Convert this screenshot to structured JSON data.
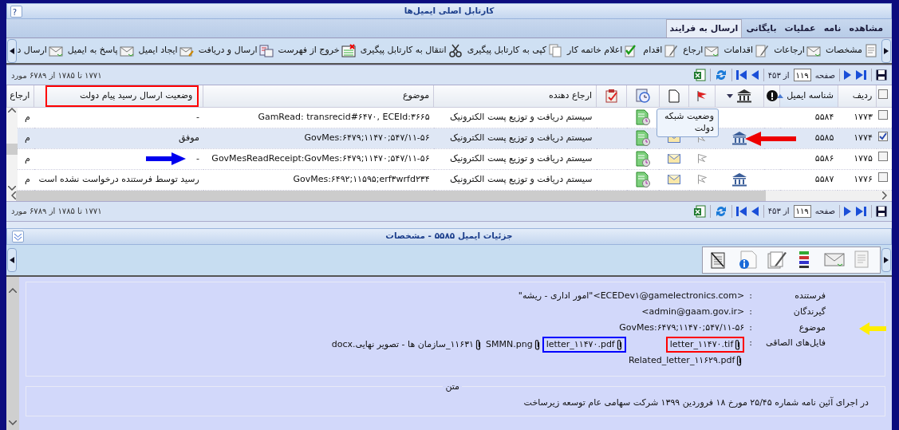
{
  "window": {
    "title": "کارتابل اصلی ایمیل‌ها",
    "help": "?"
  },
  "tabs": [
    {
      "label": "مشاهده",
      "selected": false
    },
    {
      "label": "نامه",
      "selected": false
    },
    {
      "label": "عملیات",
      "selected": false
    },
    {
      "label": "بایگانی",
      "selected": false
    },
    {
      "label": "ارسال به فرایند",
      "selected": true
    }
  ],
  "toolbar": [
    {
      "label": "مشخصات"
    },
    {
      "label": "ارجاعات"
    },
    {
      "label": "اقدامات"
    },
    {
      "label": "ارجاع"
    },
    {
      "label": "اقدام"
    },
    {
      "label": "اعلام خاتمه کار"
    },
    {
      "label": "کپی به کارتابل پیگیری"
    },
    {
      "label": "انتقال به کارتابل پیگیری"
    },
    {
      "label": "خروج از فهرست"
    },
    {
      "label": "ارسال و دریافت"
    },
    {
      "label": "ایجاد ایمیل"
    },
    {
      "label": "پاسخ به ایمیل"
    },
    {
      "label": "ارسال د"
    }
  ],
  "pager_top": {
    "page_label": "صفحه",
    "page": "۱۱۹",
    "of": "از ۴۵۳",
    "summary": "۱۷۷۱ تا ۱۷۸۵ از ۶۷۸۹ مورد"
  },
  "grid": {
    "columns": [
      {
        "kind": "check"
      },
      {
        "kind": "text",
        "label": "ردیف"
      },
      {
        "kind": "text",
        "label": "شناسه ایمیل",
        "sorted": true
      },
      {
        "kind": "icon"
      },
      {
        "kind": "icon",
        "dropdown": true
      },
      {
        "kind": "icon"
      },
      {
        "kind": "icon"
      },
      {
        "kind": "icon"
      },
      {
        "kind": "icon"
      },
      {
        "kind": "text",
        "label": "ارجاع دهنده"
      },
      {
        "kind": "text",
        "label": "موضوع"
      },
      {
        "kind": "text",
        "label": "وضعیت ارسال رسید پیام دولت",
        "annotation": {
          "kind": "box",
          "color": "#ff0000"
        }
      },
      {
        "kind": "text",
        "label": "ارجاع"
      }
    ],
    "select_all": {
      "checked": false
    },
    "tooltip": "وضعیت شبکه دولت",
    "rows": [
      {
        "checked": false,
        "selected": false,
        "row_no": "۱۷۷۳",
        "email_id": "۵۵۸۴",
        "gov_network": false,
        "sender": "سیستم دریافت و توزیع پست الکترونیک",
        "subject": "GamRead: transrecid#۶۴۷۰, ECEId:۳۶۶۵",
        "status": "-",
        "referral": "م"
      },
      {
        "checked": true,
        "selected": true,
        "row_no": "۱۷۷۴",
        "email_id": "۵۵۸۵",
        "gov_network": true,
        "flag": true,
        "envelope": true,
        "sender": "سیستم دریافت و توزیع پست الکترونیک",
        "subject": "GovMes:۶۴۷۹;۱۱۴۷۰;۵۴۷/۱۱-۵۶",
        "status": "موفق",
        "referral": "م",
        "annotation": {
          "kind": "left_arrow",
          "color": "#ee0000"
        }
      },
      {
        "checked": false,
        "selected": false,
        "row_no": "۱۷۷۵",
        "email_id": "۵۵۸۶",
        "gov_network": false,
        "flag": true,
        "envelope": true,
        "sender": "سیستم دریافت و توزیع پست الکترونیک",
        "subject": "GovMesReadReceipt:GovMes:۶۴۷۹;۱۱۴۷۰;۵۴۷/۱۱-۵۶",
        "status": "-",
        "referral": "م",
        "annotation": {
          "kind": "right_arrow",
          "color": "#0000ee"
        }
      },
      {
        "checked": false,
        "selected": false,
        "row_no": "۱۷۷۶",
        "email_id": "۵۵۸۷",
        "gov_network": true,
        "flag": true,
        "envelope": true,
        "sender": "سیستم دریافت و توزیع پست الکترونیک",
        "subject": "GovMes:۶۴۹۲;۱۱۵۹۵;erf۳wrfd۲۳۴",
        "status": "رسید توسط فرستنده درخواست نشده است",
        "referral": "م"
      }
    ]
  },
  "pager_bottom": {
    "page_label": "صفحه",
    "page": "۱۱۹",
    "of": "از ۴۵۳",
    "summary": "۱۷۷۱ تا ۱۷۸۵ از ۶۷۸۹ مورد"
  },
  "details": {
    "title": "جزئیات ایمیل ۵۵۸۵ - مشخصات",
    "fields": [
      {
        "label": "فرستنده",
        "colon": ":",
        "value": "<ECEDev۱@gamelectronics.com>\"امور اداری - ریشه\""
      },
      {
        "label": "گیرندگان",
        "colon": ":",
        "value": "<admin@gaam.gov.ir>"
      },
      {
        "label": "موضوع",
        "colon": ":",
        "value": "GovMes:۶۴۷۹;۱۱۴۷۰;۵۴۷/۱۱-۵۶",
        "annotation": {
          "kind": "left_arrow",
          "color": "#ffee00"
        }
      }
    ],
    "attachments_label": "فایل‌های الصاقی",
    "attachments_colon": ":",
    "attachments": [
      {
        "name": "letter_۱۱۴۷۰.tif",
        "annotation": {
          "kind": "box",
          "color": "#ff0000"
        }
      },
      {
        "name": "letter_۱۱۴۷۰.pdf",
        "annotation": {
          "kind": "box",
          "color": "#0000ff"
        }
      },
      {
        "name": "SMMN.png"
      },
      {
        "name": "۱۱۶۳۱_سازمان ها - تصویر نهایی.docx"
      },
      {
        "name": "Related_letter_۱۱۶۲۹.pdf"
      }
    ],
    "body_legend": "متن",
    "body": "در اجرای آئین نامه شماره ۲۵/۴۵ مورخ ۱۸ فروردین ۱۳۹۹ شرکت سهامی عام توسعه زیرساخت"
  }
}
